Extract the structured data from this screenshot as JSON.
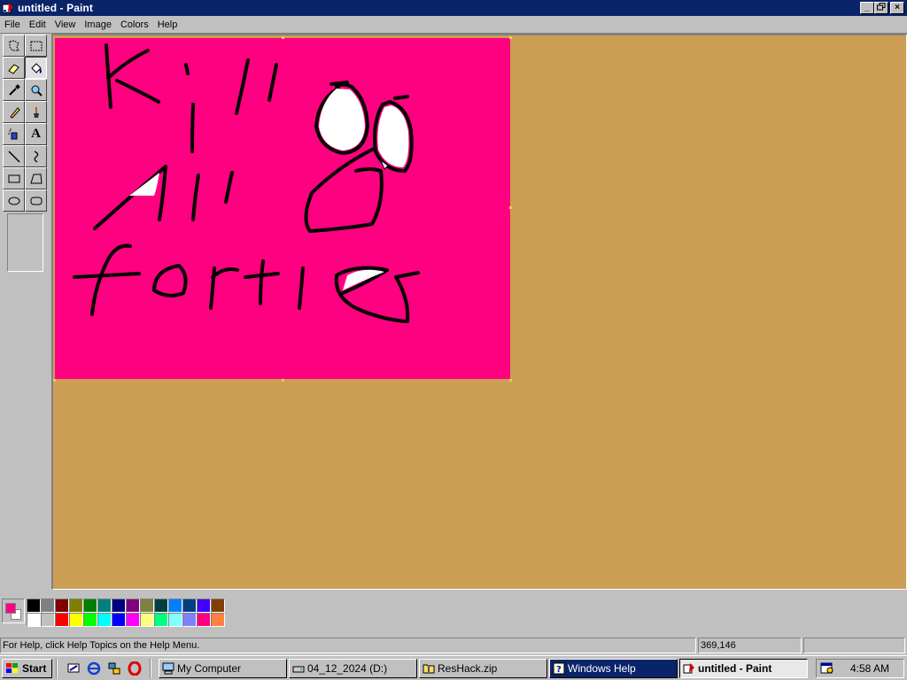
{
  "window": {
    "title": "untitled - Paint",
    "minimize": "_",
    "maximize": "▫",
    "close": "×"
  },
  "menu": [
    "File",
    "Edit",
    "View",
    "Image",
    "Colors",
    "Help"
  ],
  "tools": [
    {
      "name": "free-select-tool",
      "icon": "free-form-select-icon"
    },
    {
      "name": "select-tool",
      "icon": "rect-select-icon"
    },
    {
      "name": "eraser-tool",
      "icon": "eraser-icon"
    },
    {
      "name": "fill-tool",
      "icon": "fill-bucket-icon",
      "active": true
    },
    {
      "name": "pick-color-tool",
      "icon": "eyedropper-icon"
    },
    {
      "name": "magnifier-tool",
      "icon": "magnifier-icon"
    },
    {
      "name": "pencil-tool",
      "icon": "pencil-icon"
    },
    {
      "name": "brush-tool",
      "icon": "brush-icon"
    },
    {
      "name": "airbrush-tool",
      "icon": "airbrush-icon"
    },
    {
      "name": "text-tool",
      "icon": "text-icon",
      "glyph": "A"
    },
    {
      "name": "line-tool",
      "icon": "line-icon"
    },
    {
      "name": "curve-tool",
      "icon": "curve-icon"
    },
    {
      "name": "rectangle-tool",
      "icon": "rectangle-icon"
    },
    {
      "name": "polygon-tool",
      "icon": "polygon-icon"
    },
    {
      "name": "ellipse-tool",
      "icon": "ellipse-icon"
    },
    {
      "name": "rounded-rect-tool",
      "icon": "rounded-rect-icon"
    }
  ],
  "colors": {
    "foreground": "#ff0080",
    "background": "#ffffff",
    "canvas": "#ff0080",
    "workspace": "#cc9e54",
    "palette_top": [
      "#000000",
      "#808080",
      "#800000",
      "#808000",
      "#008000",
      "#008080",
      "#000080",
      "#800080",
      "#808040",
      "#004040",
      "#0080ff",
      "#004080",
      "#4000ff",
      "#804000"
    ],
    "palette_bottom": [
      "#ffffff",
      "#c0c0c0",
      "#ff0000",
      "#ffff00",
      "#00ff00",
      "#00ffff",
      "#0000ff",
      "#ff00ff",
      "#ffff80",
      "#00ff80",
      "#80ffff",
      "#8080ff",
      "#ff0080",
      "#ff8040"
    ]
  },
  "status": {
    "help": "For Help, click Help Topics on the Help Menu.",
    "coords": "369,146",
    "size": ""
  },
  "taskbar": {
    "start": "Start",
    "quick_launch": [
      "show-desktop-icon",
      "ie-icon",
      "network-icon",
      "opera-icon"
    ],
    "tasks": [
      {
        "label": "My Computer",
        "icon": "computer-icon"
      },
      {
        "label": "04_12_2024 (D:)",
        "icon": "drive-icon"
      },
      {
        "label": "ResHack.zip",
        "icon": "zip-folder-icon"
      },
      {
        "label": "Windows Help",
        "icon": "help-icon"
      },
      {
        "label": "untitled - Paint",
        "icon": "paint-icon"
      }
    ],
    "clock": "4:58 AM"
  }
}
